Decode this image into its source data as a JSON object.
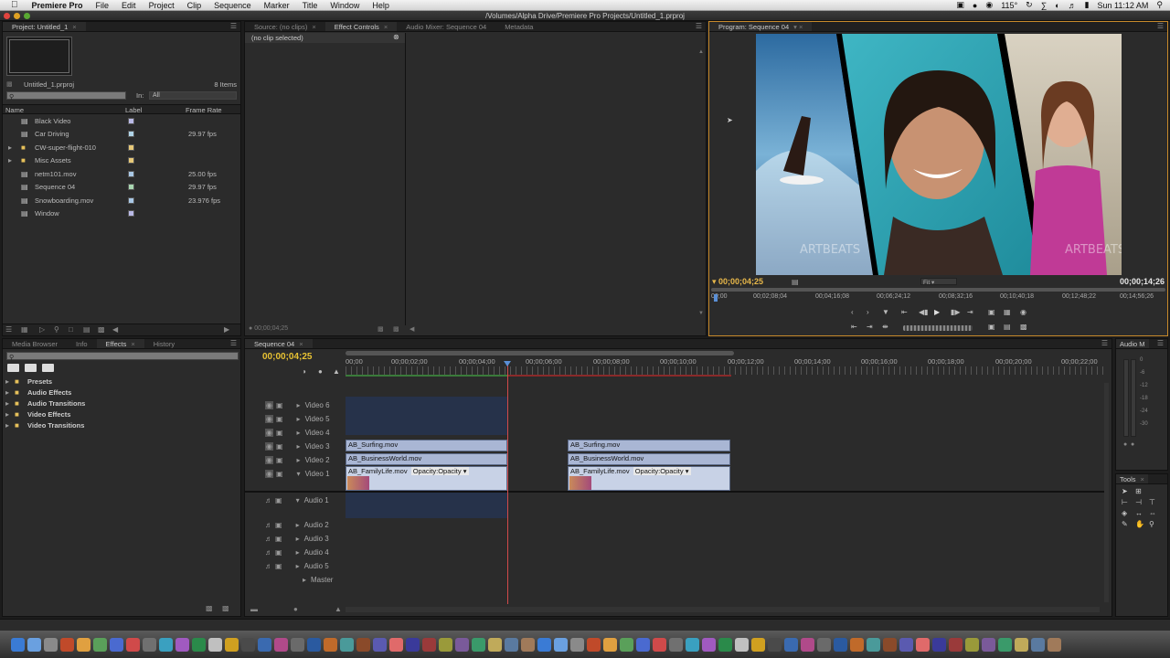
{
  "menubar": {
    "app": "Premiere Pro",
    "menus": [
      "File",
      "Edit",
      "Project",
      "Clip",
      "Sequence",
      "Marker",
      "Title",
      "Window",
      "Help"
    ],
    "status": {
      "temp": "115°",
      "clock": "Sun 11:12 AM"
    }
  },
  "window": {
    "title": "/Volumes/Alpha Drive/Premiere Pro Projects/Untitled_1.prproj"
  },
  "project": {
    "tab": "Project: Untitled_1",
    "filename": "Untitled_1.prproj",
    "item_count": "8 Items",
    "in_label": "In:",
    "in_value": "All",
    "columns": {
      "name": "Name",
      "label": "Label",
      "frame_rate": "Frame Rate"
    },
    "items": [
      {
        "name": "Black Video",
        "color": "#b9b9e6",
        "fps": "",
        "type": "file"
      },
      {
        "name": "Car Driving",
        "color": "#b0d4e8",
        "fps": "29.97 fps",
        "type": "file"
      },
      {
        "name": "CW-super-flight-010",
        "color": "#e6c878",
        "fps": "",
        "type": "folder"
      },
      {
        "name": "Misc Assets",
        "color": "#e6c878",
        "fps": "",
        "type": "folder"
      },
      {
        "name": "netm101.mov",
        "color": "#a9c8e6",
        "fps": "25.00 fps",
        "type": "file"
      },
      {
        "name": "Sequence 04",
        "color": "#a8d6b0",
        "fps": "29.97 fps",
        "type": "file"
      },
      {
        "name": "Snowboarding.mov",
        "color": "#a9c8e6",
        "fps": "23.976 fps",
        "type": "file"
      },
      {
        "name": "Window",
        "color": "#b9b9e6",
        "fps": "",
        "type": "file"
      }
    ]
  },
  "source": {
    "tabs": [
      "Source: (no clips)",
      "Effect Controls",
      "Audio Mixer: Sequence 04",
      "Metadata"
    ],
    "no_clip": "(no clip selected)",
    "timecode": "00;00;04;25"
  },
  "program": {
    "tab": "Program: Sequence 04",
    "timecode_left": "00;00;04;25",
    "timecode_right": "00;00;14;26",
    "fit": "Fit",
    "watermark": "ARTBEATS",
    "ruler": [
      "00;00",
      "00;02;08;04",
      "00;04;16;08",
      "00;06;24;12",
      "00;08;32;16",
      "00;10;40;18",
      "00;12;48;22",
      "00;14;56;26"
    ]
  },
  "effects": {
    "tabs": [
      "Media Browser",
      "Info",
      "Effects",
      "History"
    ],
    "folders": [
      "Presets",
      "Audio Effects",
      "Audio Transitions",
      "Video Effects",
      "Video Transitions"
    ]
  },
  "timeline": {
    "tab": "Sequence 04",
    "timecode": "00;00;04;25",
    "ruler": [
      "00;00",
      "00;00;02;00",
      "00;00;04;00",
      "00;00;06;00",
      "00;00;08;00",
      "00;00;10;00",
      "00;00;12;00",
      "00;00;14;00",
      "00;00;16;00",
      "00;00;18;00",
      "00;00;20;00",
      "00;00;22;00"
    ],
    "video_tracks": [
      "Video 6",
      "Video 5",
      "Video 4",
      "Video 3",
      "Video 2",
      "Video 1"
    ],
    "audio_tracks": [
      "Audio 1",
      "Audio 2",
      "Audio 3",
      "Audio 4",
      "Audio 5",
      "Master"
    ],
    "clips": {
      "surfing": "AB_Surfing.mov",
      "business": "AB_BusinessWorld.mov",
      "family": "AB_FamilyLife.mov",
      "opacity": "Opacity:Opacity"
    }
  },
  "audio_meter": {
    "tab": "Audio M",
    "levels": [
      "0",
      "-6",
      "-12",
      "-18",
      "-24",
      "-30"
    ]
  },
  "tools": {
    "tab": "Tools"
  }
}
